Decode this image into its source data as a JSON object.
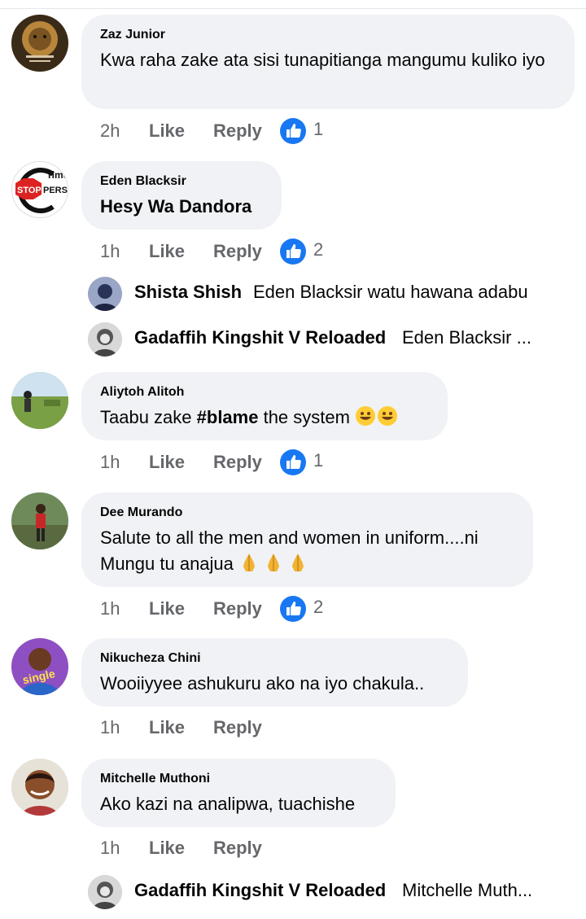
{
  "comments": [
    {
      "author": "Zaz Junior",
      "text": "Kwa raha zake ata sisi tunapitianga mangumu kuliko iyo",
      "time": "2h",
      "like_label": "Like",
      "reply_label": "Reply",
      "reaction_count": "1"
    },
    {
      "author": "Eden Blacksir",
      "text": "Hesy Wa Dandora",
      "time": "1h",
      "like_label": "Like",
      "reply_label": "Reply",
      "reaction_count": "2",
      "avatar_text": "Crime STOPPERS"
    },
    {
      "author": "Aliytoh Alitoh",
      "text_before": "Taabu zake ",
      "hashtag": "#blame",
      "text_after": " the system",
      "emoji": "rolling-on-floor-laughing x2",
      "time": "1h",
      "like_label": "Like",
      "reply_label": "Reply",
      "reaction_count": "1"
    },
    {
      "author": "Dee Murando",
      "text_line1": "Salute to all the men and women in uniform....ni",
      "text_line2": "Mungu tu anajua",
      "emoji": "folded-hands x3",
      "time": "1h",
      "like_label": "Like",
      "reply_label": "Reply",
      "reaction_count": "2"
    },
    {
      "author": "Nikucheza Chini",
      "text": "Wooiiyyee ashukuru ako na iyo chakula..",
      "time": "1h",
      "like_label": "Like",
      "reply_label": "Reply",
      "avatar_text": "single"
    },
    {
      "author": "Mitchelle Muthoni",
      "text": "Ako kazi na analipwa, tuachishe",
      "time": "1h",
      "like_label": "Like",
      "reply_label": "Reply"
    }
  ],
  "replies": [
    {
      "author": "Shista Shish",
      "text": "Eden Blacksir watu hawana adabu"
    },
    {
      "author": "Gadaffih Kingshit V Reloaded",
      "text": "Eden Blacksir ..."
    },
    {
      "author": "Gadaffih Kingshit V Reloaded",
      "text": "Mitchelle Muth..."
    }
  ],
  "colors": {
    "bubble": "#f0f2f5",
    "meta_text": "#65676b",
    "like_blue": "#1877f2"
  }
}
